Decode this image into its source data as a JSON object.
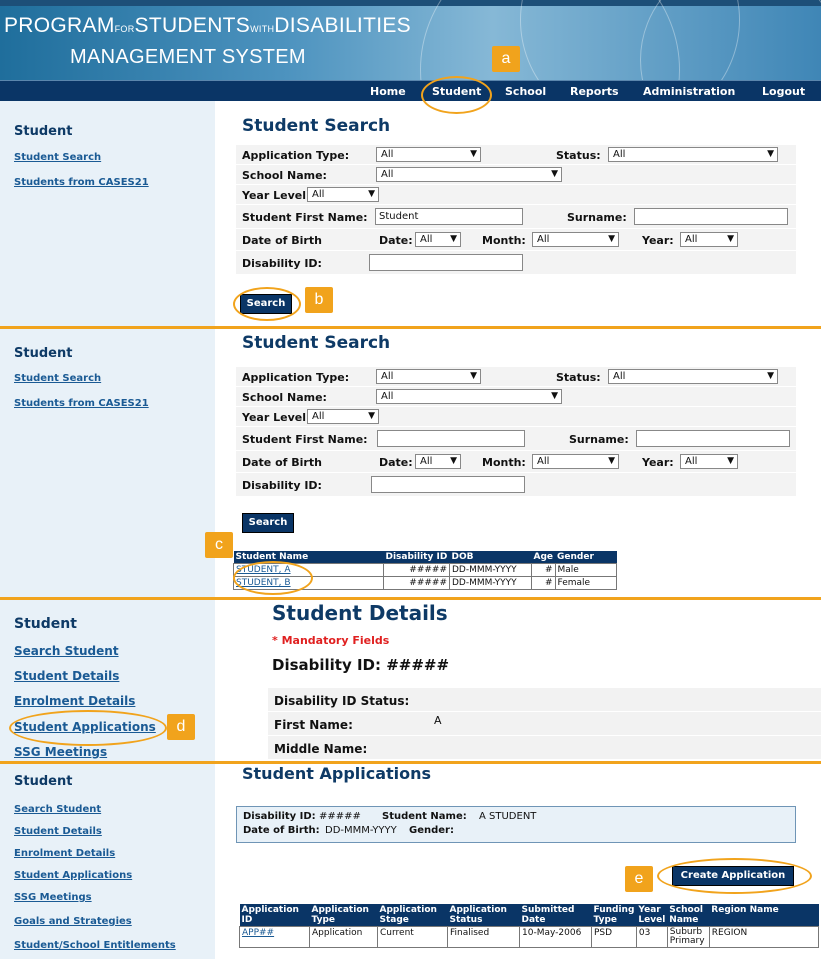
{
  "header": {
    "title_line1": [
      "PROGRAM",
      "FOR",
      "STUDENTS",
      "WITH",
      "DISABILITIES"
    ],
    "title_line2": "MANAGEMENT SYSTEM",
    "nav": [
      "Home",
      "Student",
      "School",
      "Reports",
      "Administration",
      "Logout"
    ],
    "active_nav": "Student"
  },
  "annotations": {
    "a": "a",
    "b": "b",
    "c": "c",
    "d": "d",
    "e": "e"
  },
  "panel1": {
    "sidebar_title": "Student",
    "sidebar_links": [
      "Student Search",
      "Students from CASES21"
    ],
    "title": "Student Search",
    "app_type_label": "Application Type:",
    "app_type_value": "All",
    "status_label": "Status:",
    "status_value": "All",
    "school_label": "School Name:",
    "school_value": "All",
    "year_label": "Year Level:",
    "year_value": "All",
    "first_name_label": "Student First Name:",
    "first_name_value": "Student",
    "surname_label": "Surname:",
    "surname_value": "",
    "dob_label": "Date of Birth",
    "date_label": "Date:",
    "date_value": "All",
    "month_label": "Month:",
    "month_value": "All",
    "yr_label": "Year:",
    "yr_value": "All",
    "disability_label": "Disability ID:",
    "disability_value": "",
    "search_button": "Search"
  },
  "panel2": {
    "sidebar_title": "Student",
    "sidebar_links": [
      "Student Search",
      "Students from CASES21"
    ],
    "title": "Student Search",
    "app_type_label": "Application Type:",
    "app_type_value": "All",
    "status_label": "Status:",
    "status_value": "All",
    "school_label": "School Name:",
    "school_value": "All",
    "year_label": "Year Level:",
    "year_value": "All",
    "first_name_label": "Student First Name:",
    "first_name_value": "",
    "surname_label": "Surname:",
    "surname_value": "",
    "dob_label": "Date of Birth",
    "date_label": "Date:",
    "date_value": "All",
    "month_label": "Month:",
    "month_value": "All",
    "yr_label": "Year:",
    "yr_value": "All",
    "disability_label": "Disability ID:",
    "disability_value": "",
    "search_button": "Search",
    "results_headers": [
      "Student Name",
      "Disability ID",
      "DOB",
      "Age",
      "Gender"
    ],
    "results_rows": [
      [
        "STUDENT, A",
        "#####",
        "DD-MMM-YYYY",
        "#",
        "Male"
      ],
      [
        "STUDENT, B",
        "#####",
        "DD-MMM-YYYY",
        "#",
        "Female"
      ]
    ]
  },
  "panel3": {
    "sidebar_title": "Student",
    "sidebar_links": [
      "Search Student",
      "Student Details",
      "Enrolment Details",
      "Student Applications",
      "SSG Meetings"
    ],
    "title": "Student Details",
    "mandatory": "* Mandatory Fields",
    "disability_heading": "Disability ID: #####",
    "fields": [
      {
        "label": "Disability ID Status:",
        "value": ""
      },
      {
        "label": "First Name:",
        "value": "A"
      },
      {
        "label": "Middle Name:",
        "value": ""
      }
    ]
  },
  "panel4": {
    "sidebar_title": "Student",
    "sidebar_links": [
      "Search Student",
      "Student Details",
      "Enrolment Details",
      "Student Applications",
      "SSG Meetings",
      "Goals and Strategies",
      "Student/School Entitlements"
    ],
    "title": "Student Applications",
    "info_disability_label": "Disability ID:",
    "info_disability_value": "#####",
    "info_name_label": "Student Name:",
    "info_name_value": "A STUDENT",
    "info_dob_label": "Date of Birth:",
    "info_dob_value": "DD-MMM-YYYY",
    "info_gender_label": "Gender:",
    "info_gender_value": "",
    "create_button": "Create Application",
    "table_headers": [
      "Application ID",
      "Application Type",
      "Application Stage",
      "Application Status",
      "Submitted Date",
      "Funding Type",
      "Year Level",
      "School Name",
      "Region Name"
    ],
    "table_rows": [
      [
        "APP##",
        "Application",
        "Current",
        "Finalised",
        "10-May-2006",
        "PSD",
        "03",
        "Suburb Primary",
        "REGION"
      ]
    ]
  },
  "colors": {
    "navy": "#0a3566",
    "accent_orange": "#f1a31c",
    "sidebar_bg": "#e8f1f8",
    "mandatory_red": "#e02020",
    "link": "#1a5a94"
  }
}
